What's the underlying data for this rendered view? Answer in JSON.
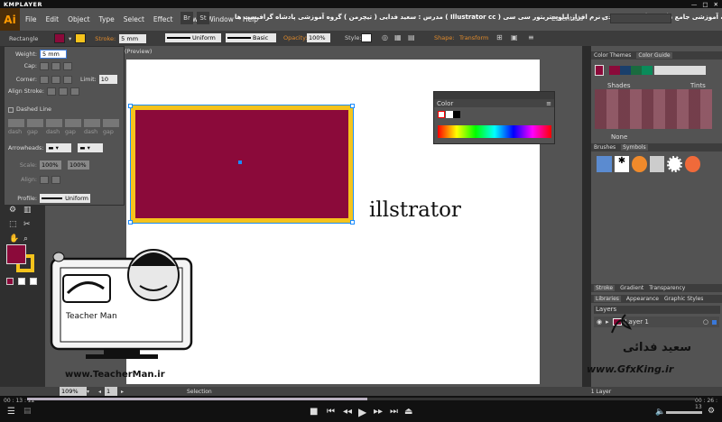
{
  "player": {
    "brand": "KMPLAYER",
    "time_elapsed": "00 : 13 : 22",
    "time_total": "00 : 26 : 13",
    "progress": 0.51
  },
  "app": {
    "logo": "Ai",
    "course_title": "مجموعه آموزشی جامع ، گام به گام و کاربردی نرم افزار ایلوستریتور سی سی ( Illustrator cc )   مدرس : سعید فدایی ( تیچرمن ) گروه آموزشی پادشاه گرافیست ها",
    "workspace": "Essentials"
  },
  "menu": [
    "File",
    "Edit",
    "Object",
    "Type",
    "Select",
    "Effect",
    "View",
    "Window",
    "Help"
  ],
  "control": {
    "object": "Rectangle",
    "stroke_label": "Stroke:",
    "stroke_value": "5 mm",
    "profile1": "Uniform",
    "profile2": "Basic",
    "opacity_label": "Opacity:",
    "opacity_value": "100%",
    "style_label": "Style:",
    "shape": "Shape:",
    "transform": "Transform"
  },
  "stroke_panel": {
    "weight_label": "Weight:",
    "weight_value": "5 mm",
    "cap_label": "Cap:",
    "corner_label": "Corner:",
    "limit_label": "Limit:",
    "limit_value": "10",
    "align_label": "Align Stroke:",
    "dashed_label": "Dashed Line",
    "dash_labels": [
      "dash",
      "gap",
      "dash",
      "gap",
      "dash",
      "gap"
    ],
    "arrowheads_label": "Arrowheads:",
    "scale_label": "Scale:",
    "scale1": "100%",
    "scale2": "100%",
    "align2_label": "Align:",
    "profile_label": "Profile:",
    "profile_value": "Uniform"
  },
  "document": {
    "tab": "(Preview)",
    "sample_text": "illstrator"
  },
  "color_panel": {
    "title": "Color"
  },
  "dock": {
    "tabs1": [
      "Color Themes",
      "Color Guide"
    ],
    "shades": "Shades",
    "tints": "Tints",
    "none": "None",
    "tabs2": [
      "Brushes",
      "Symbols"
    ],
    "tabs3": [
      "Stroke",
      "Gradient",
      "Transparency"
    ],
    "tabs4": [
      "Libraries",
      "Appearance",
      "Graphic Styles"
    ],
    "layers_title": "Layers",
    "layer_name": "Layer 1",
    "layer_count": "1 Layer"
  },
  "status": {
    "zoom": "109%",
    "page": "1",
    "tool": "Selection"
  },
  "overlay": {
    "site1": "www.TeacherMan.ir",
    "site2": "www.GfxKing.ir",
    "brand_en": "Teacher Man",
    "brand_fa": "تیچرمن",
    "name_fa": "سعید فدائی"
  },
  "colors": {
    "fill": "#8b0a3a",
    "stroke": "#f5c31c",
    "accent": "#e08a2b"
  }
}
